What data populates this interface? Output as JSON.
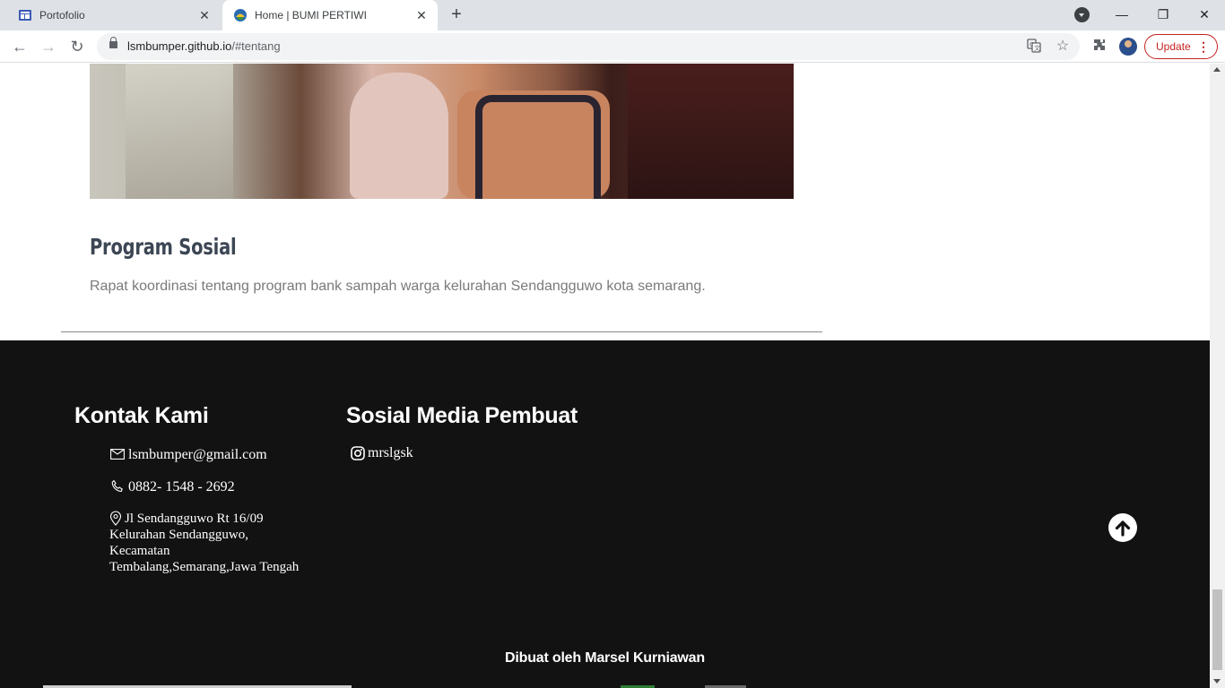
{
  "browser": {
    "tabs": [
      {
        "label": "Portofolio",
        "icon": "page-layout-icon",
        "close": "✕"
      },
      {
        "label": "Home | BUMI PERTIWI",
        "icon": "site-logo-icon",
        "close": "✕"
      }
    ],
    "new_tab": "+",
    "window_controls": {
      "minimize": "—",
      "restore": "❐",
      "close": "✕"
    },
    "nav": {
      "back": "←",
      "forward": "→",
      "reload": "↻"
    },
    "url": {
      "host": "lsmbumper.github.io",
      "path": "/#tentang"
    },
    "update_label": "Update",
    "menu_glyph": "⋮",
    "accent": "#c5221f"
  },
  "content": {
    "title": "Program Sosial",
    "description": "Rapat koordinasi tentang program bank sampah warga kelurahan Sendangguwo kota semarang."
  },
  "footer": {
    "contact_heading": "Kontak Kami",
    "email": "lsmbumper@gmail.com",
    "phone": "0882- 1548 - 2692",
    "address_lines": [
      "Jl Sendangguwo Rt 16/09",
      "Kelurahan Sendangguwo,",
      "Kecamatan",
      "Tembalang,Semarang,Jawa Tengah"
    ],
    "social_heading": "Sosial Media Pembuat",
    "instagram": "mrslgsk",
    "credit": "Dibuat oleh Marsel Kurniawan",
    "background": "#121212"
  }
}
